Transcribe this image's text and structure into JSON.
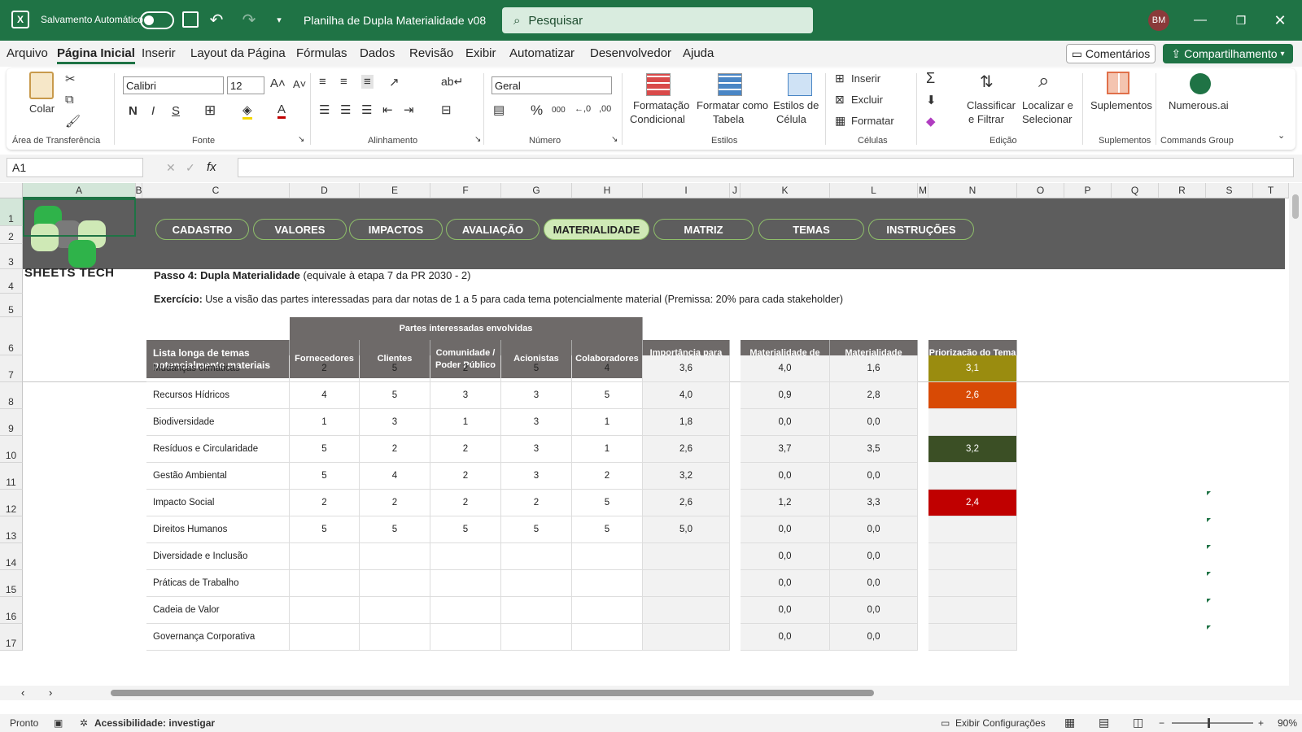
{
  "titlebar": {
    "autosave": "Salvamento Automático",
    "doc_title": "Planilha de Dupla Materialidade v08",
    "search": "Pesquisar",
    "avatar": "BM"
  },
  "menu": [
    "Arquivo",
    "Página Inicial",
    "Inserir",
    "Layout da Página",
    "Fórmulas",
    "Dados",
    "Revisão",
    "Exibir",
    "Automatizar",
    "Desenvolvedor",
    "Ajuda"
  ],
  "buttons": {
    "comments": "Comentários",
    "share": "Compartilhamento"
  },
  "ribbon": {
    "clipboard": {
      "paste": "Colar",
      "group": "Área de Transferência"
    },
    "font": {
      "family": "Calibri",
      "size": "12",
      "bold": "N",
      "italic": "I",
      "underline": "S",
      "group": "Fonte"
    },
    "align": {
      "group": "Alinhamento"
    },
    "number": {
      "format": "Geral",
      "group": "Número"
    },
    "styles": {
      "cond1": "Formatação",
      "cond2": "Condicional",
      "table1": "Formatar como",
      "table2": "Tabela",
      "cell1": "Estilos de",
      "cell2": "Célula",
      "group": "Estilos"
    },
    "cells": {
      "insert": "Inserir",
      "delete": "Excluir",
      "format": "Formatar",
      "group": "Células"
    },
    "edit": {
      "sort1": "Classificar",
      "sort2": "e Filtrar",
      "find1": "Localizar e",
      "find2": "Selecionar",
      "group": "Edição"
    },
    "addins": {
      "label": "Suplementos",
      "group": "Suplementos"
    },
    "numerous": {
      "label": "Numerous.ai",
      "group": "Commands Group"
    }
  },
  "formula": {
    "namebox": "A1",
    "fx": "fx"
  },
  "columns": [
    "A",
    "B",
    "C",
    "D",
    "E",
    "F",
    "G",
    "H",
    "I",
    "J",
    "K",
    "L",
    "M",
    "N",
    "O",
    "P",
    "Q",
    "R",
    "S",
    "T"
  ],
  "rows": [
    "1",
    "2",
    "3",
    "4",
    "5",
    "6",
    "7",
    "8",
    "9",
    "10",
    "11",
    "12",
    "13",
    "14",
    "15",
    "16",
    "17"
  ],
  "logo_text": "SHEETS TECH",
  "nav": [
    "CADASTRO",
    "VALORES",
    "IMPACTOS",
    "AVALIAÇÃO",
    "MATERIALIDADE",
    "MATRIZ",
    "TEMAS",
    "INSTRUÇÕES"
  ],
  "step": {
    "bold": "Passo 4: Dupla Materialidade",
    "rest": " (equivale à etapa 7 da PR 2030 - 2)"
  },
  "exercise": {
    "bold": "Exercício:",
    "rest": " Use a visão das partes interessadas para dar notas de 1 a 5 para cada tema potencialmente material (Premissa: 20% para cada stakeholder)"
  },
  "table": {
    "group_header": "Partes interessadas envolvidas",
    "h_topic": "Lista longa de temas potencialmente materiais",
    "h_stake": [
      "Fornecedores",
      "Clientes",
      "Comunidade / Poder Público",
      "Acionistas",
      "Colaboradores"
    ],
    "h_importance": "Importância para Partes Interessadas",
    "h_impact": "Materialidade de Impacto (y)",
    "h_fin": "Materialidade Financeira (x)",
    "h_prio": "Priorização do Tema Material",
    "rows": [
      {
        "topic": "Mudanças climáticas",
        "v": [
          "2",
          "5",
          "2",
          "5",
          "4"
        ],
        "imp": "3,6",
        "y": "4,0",
        "x": "1,6",
        "prio": "3,1",
        "color": "#9a8c0f"
      },
      {
        "topic": "Recursos Hídricos",
        "v": [
          "4",
          "5",
          "3",
          "3",
          "5"
        ],
        "imp": "4,0",
        "y": "0,9",
        "x": "2,8",
        "prio": "2,6",
        "color": "#d84a05"
      },
      {
        "topic": "Biodiversidade",
        "v": [
          "1",
          "3",
          "1",
          "3",
          "1"
        ],
        "imp": "1,8",
        "y": "0,0",
        "x": "0,0",
        "prio": "",
        "color": ""
      },
      {
        "topic": "Resíduos e Circularidade",
        "v": [
          "5",
          "2",
          "2",
          "3",
          "1"
        ],
        "imp": "2,6",
        "y": "3,7",
        "x": "3,5",
        "prio": "3,2",
        "color": "#3b4f25"
      },
      {
        "topic": "Gestão Ambiental",
        "v": [
          "5",
          "4",
          "2",
          "3",
          "2"
        ],
        "imp": "3,2",
        "y": "0,0",
        "x": "0,0",
        "prio": "",
        "color": ""
      },
      {
        "topic": "Impacto Social",
        "v": [
          "2",
          "2",
          "2",
          "2",
          "5"
        ],
        "imp": "2,6",
        "y": "1,2",
        "x": "3,3",
        "prio": "2,4",
        "color": "#c00000"
      },
      {
        "topic": "Direitos Humanos",
        "v": [
          "5",
          "5",
          "5",
          "5",
          "5"
        ],
        "imp": "5,0",
        "y": "0,0",
        "x": "0,0",
        "prio": "",
        "color": ""
      },
      {
        "topic": "Diversidade e Inclusão",
        "v": [
          "",
          "",
          "",
          "",
          ""
        ],
        "imp": "",
        "y": "0,0",
        "x": "0,0",
        "prio": "",
        "color": ""
      },
      {
        "topic": "Práticas de Trabalho",
        "v": [
          "",
          "",
          "",
          "",
          ""
        ],
        "imp": "",
        "y": "0,0",
        "x": "0,0",
        "prio": "",
        "color": ""
      },
      {
        "topic": "Cadeia de Valor",
        "v": [
          "",
          "",
          "",
          "",
          ""
        ],
        "imp": "",
        "y": "0,0",
        "x": "0,0",
        "prio": "",
        "color": ""
      },
      {
        "topic": "Governança Corporativa",
        "v": [
          "",
          "",
          "",
          "",
          ""
        ],
        "imp": "",
        "y": "0,0",
        "x": "0,0",
        "prio": "",
        "color": ""
      }
    ]
  },
  "status": {
    "ready": "Pronto",
    "accessibility": "Acessibilidade: investigar",
    "display": "Exibir Configurações",
    "zoom": "90%"
  }
}
